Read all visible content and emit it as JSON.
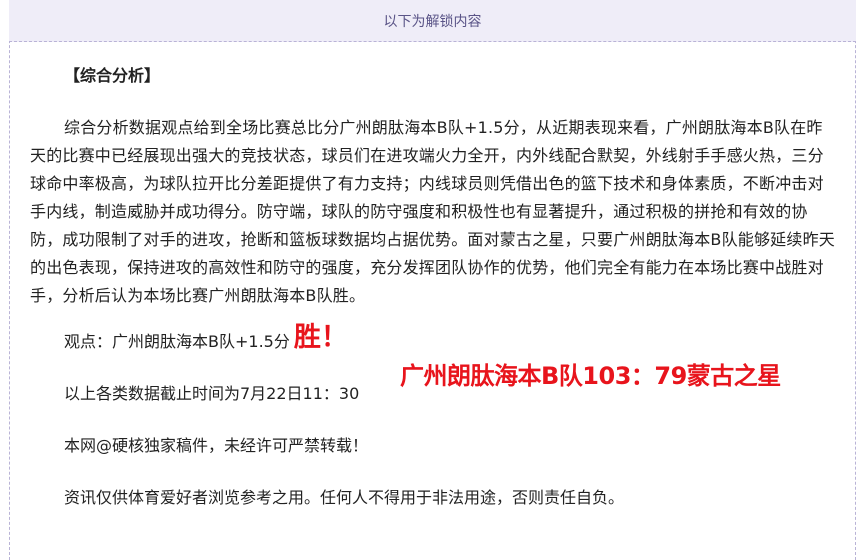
{
  "unlock_banner": "以下为解锁内容",
  "article": {
    "heading": "【综合分析】",
    "body": "综合分析数据观点给到全场比赛总比分广州朗肽海本B队+1.5分，从近期表现来看，广州朗肽海本B队在昨天的比赛中已经展现出强大的竞技状态，球员们在进攻端火力全开，内外线配合默契，外线射手手感火热，三分球命中率极高，为球队拉开比分差距提供了有力支持；内线球员则凭借出色的篮下技术和身体素质，不断冲击对手内线，制造威胁并成功得分。防守端，球队的防守强度和积极性也有显著提升，通过积极的拼抢和有效的协防，成功限制了对手的进攻，抢断和篮板球数据均占据优势。面对蒙古之星，只要广州朗肽海本B队能够延续昨天的出色表现，保持进攻的高效性和防守的强度，充分发挥团队协作的优势，他们完全有能力在本场比赛中战胜对手，分析后认为本场比赛广州朗肽海本B队胜。",
    "verdict_label": "观点：广州朗肽海本B队+1.5分",
    "verdict_result": "胜！",
    "final_score": "广州朗肽海本B队103：79蒙古之星",
    "data_cutoff": "以上各类数据截止时间为7月22日11：30",
    "copyright": "本网@硬核独家稿件，未经许可严禁转载！",
    "disclaimer": "资讯仅供体育爱好者浏览参考之用。任何人不得用于非法用途，否则责任自负。"
  },
  "colors": {
    "accent_red": "#e8141c",
    "banner_bg": "#efedf8",
    "banner_text": "#5a5487"
  }
}
